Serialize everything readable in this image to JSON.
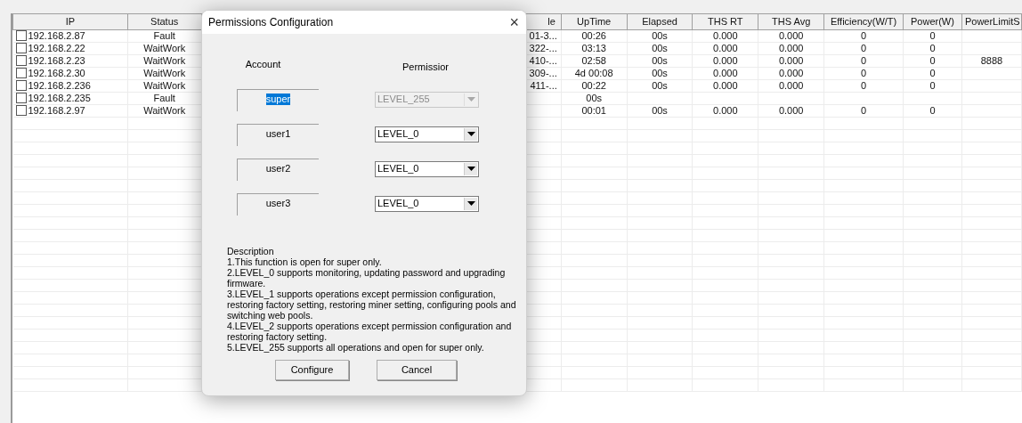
{
  "table": {
    "columns": [
      "IP",
      "Status",
      "le",
      "UpTime",
      "Elapsed",
      "THS RT",
      "THS Avg",
      "Efficiency(W/T)",
      "Power(W)",
      "PowerLimitS"
    ],
    "rows": [
      {
        "checked": false,
        "cells": [
          "192.168.2.87",
          "Fault",
          "01-3...",
          "00:26",
          "00s",
          "0.000",
          "0.000",
          "0",
          "0",
          null
        ]
      },
      {
        "checked": false,
        "cells": [
          "192.168.2.22",
          "WaitWork",
          "322-...",
          "03:13",
          "00s",
          "0.000",
          "0.000",
          "0",
          "0",
          null
        ]
      },
      {
        "checked": false,
        "cells": [
          "192.168.2.23",
          "WaitWork",
          "410-...",
          "02:58",
          "00s",
          "0.000",
          "0.000",
          "0",
          "0",
          "8888"
        ]
      },
      {
        "checked": false,
        "cells": [
          "192.168.2.30",
          "WaitWork",
          "309-...",
          "4d 00:08",
          "00s",
          "0.000",
          "0.000",
          "0",
          "0",
          null
        ]
      },
      {
        "checked": false,
        "cells": [
          "192.168.2.236",
          "WaitWork",
          "411-...",
          "00:22",
          "00s",
          "0.000",
          "0.000",
          "0",
          "0",
          null
        ]
      },
      {
        "checked": false,
        "cells": [
          "192.168.2.235",
          "Fault",
          null,
          "00s",
          null,
          null,
          null,
          null,
          null,
          null
        ]
      },
      {
        "checked": false,
        "cells": [
          "192.168.2.97",
          "WaitWork",
          null,
          "00:01",
          "00s",
          "0.000",
          "0.000",
          "0",
          "0",
          null
        ]
      }
    ]
  },
  "dialog": {
    "title": "Permissions Configuration",
    "close": "×",
    "account_header": "Account",
    "permission_header": "Permissior",
    "accounts": [
      {
        "name": "super",
        "selected": true,
        "permission": "LEVEL_255",
        "disabled": true
      },
      {
        "name": "user1",
        "selected": false,
        "permission": "LEVEL_0",
        "disabled": false
      },
      {
        "name": "user2",
        "selected": false,
        "permission": "LEVEL_0",
        "disabled": false
      },
      {
        "name": "user3",
        "selected": false,
        "permission": "LEVEL_0",
        "disabled": false
      }
    ],
    "description_title": "Description",
    "description": [
      "1.This function is open for super only.",
      "2.LEVEL_0 supports monitoring, updating password and upgrading firmware.",
      "3.LEVEL_1 supports operations except permission configuration, restoring factory setting, restoring miner setting, configuring pools and switching web pools.",
      "4.LEVEL_2 supports operations except permission configuration and restoring factory setting.",
      "5.LEVEL_255 supports all operations and open for super only."
    ],
    "buttons": [
      "Configure",
      "Cancel"
    ]
  }
}
